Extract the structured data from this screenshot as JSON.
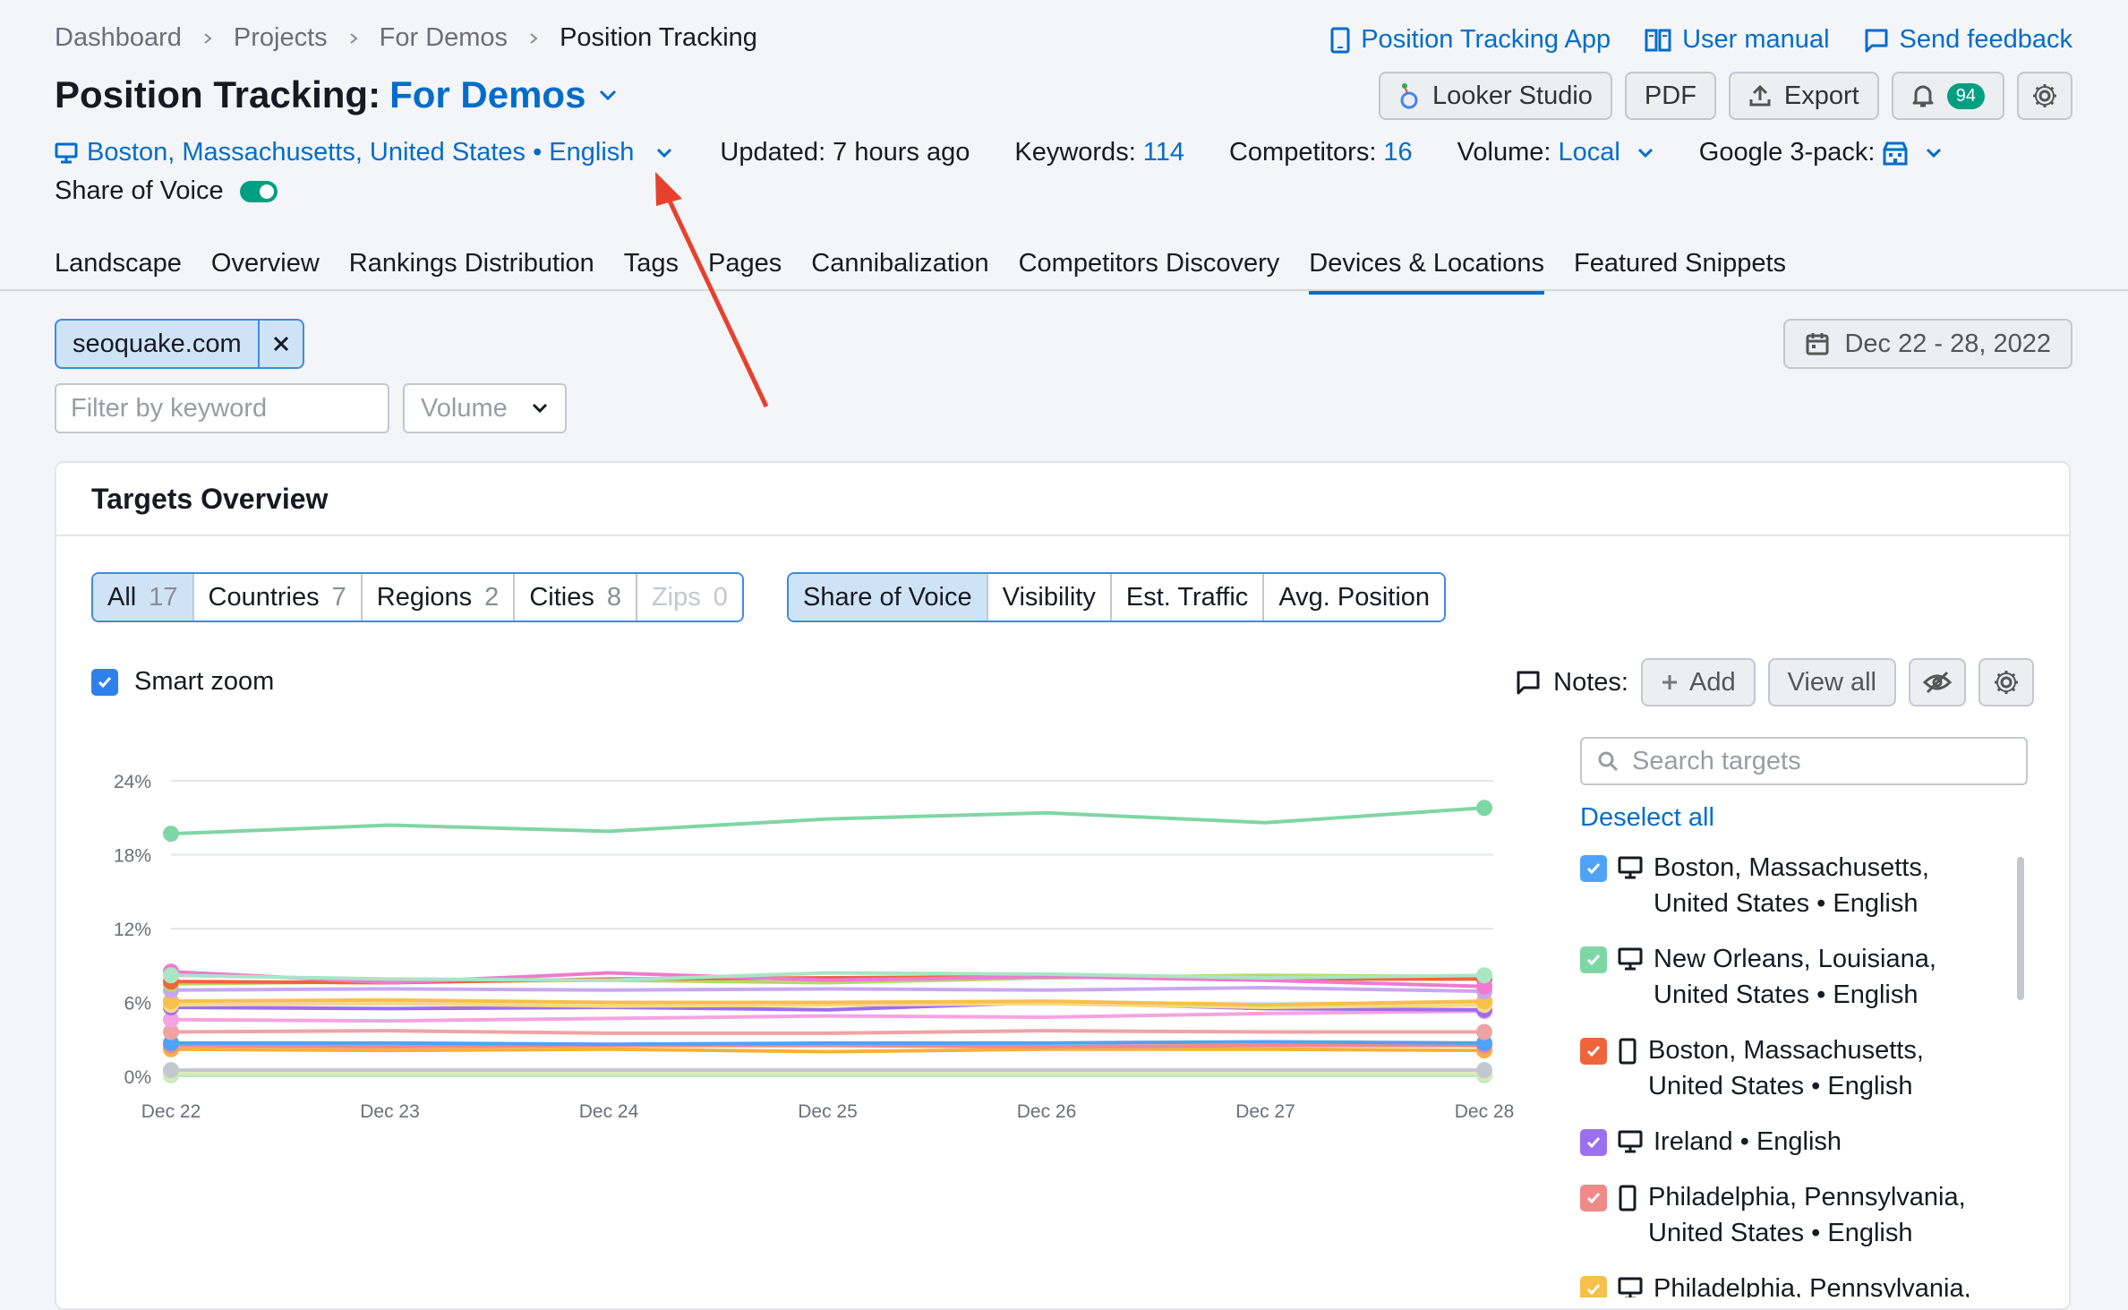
{
  "breadcrumb": [
    "Dashboard",
    "Projects",
    "For Demos",
    "Position Tracking"
  ],
  "top_links": {
    "app": "Position Tracking App",
    "manual": "User manual",
    "feedback": "Send feedback"
  },
  "title": {
    "prefix": "Position Tracking:",
    "project": "For Demos"
  },
  "toolbar": {
    "looker": "Looker Studio",
    "pdf": "PDF",
    "export": "Export",
    "notifications_count": "94"
  },
  "meta": {
    "location": "Boston, Massachusetts, United States • English",
    "updated_label": "Updated: 7 hours ago",
    "keywords_label": "Keywords:",
    "keywords_value": "114",
    "competitors_label": "Competitors:",
    "competitors_value": "16",
    "volume_label": "Volume:",
    "volume_value": "Local",
    "pack_label": "Google 3-pack:",
    "share_of_voice": "Share of Voice"
  },
  "tabs": [
    "Landscape",
    "Overview",
    "Rankings Distribution",
    "Tags",
    "Pages",
    "Cannibalization",
    "Competitors Discovery",
    "Devices & Locations",
    "Featured Snippets"
  ],
  "active_tab": "Devices & Locations",
  "domain_chip": "seoquake.com",
  "date_range": "Dec 22 - 28, 2022",
  "filter": {
    "placeholder": "Filter by keyword",
    "volume_placeholder": "Volume"
  },
  "card": {
    "title": "Targets Overview",
    "filters": [
      {
        "label": "All",
        "count": "17"
      },
      {
        "label": "Countries",
        "count": "7"
      },
      {
        "label": "Regions",
        "count": "2"
      },
      {
        "label": "Cities",
        "count": "8"
      },
      {
        "label": "Zips",
        "count": "0"
      }
    ],
    "metrics": [
      "Share of Voice",
      "Visibility",
      "Est. Traffic",
      "Avg. Position"
    ],
    "smart_zoom": "Smart zoom",
    "notes_label": "Notes:",
    "notes_add": "Add",
    "notes_view_all": "View all",
    "search_placeholder": "Search targets",
    "deselect_all": "Deselect all",
    "targets": [
      {
        "line1": "Boston, Massachusetts,",
        "line2": "United States • English",
        "color": "#4fa3f7",
        "device": "desktop"
      },
      {
        "line1": "New Orleans, Louisiana,",
        "line2": "United States • English",
        "color": "#7fd6a5",
        "device": "desktop"
      },
      {
        "line1": "Boston, Massachusetts,",
        "line2": "United States • English",
        "color": "#f0643c",
        "device": "mobile"
      },
      {
        "line1": "Ireland • English",
        "line2": "",
        "color": "#9c6ef0",
        "device": "desktop"
      },
      {
        "line1": "Philadelphia, Pennsylvania,",
        "line2": "United States • English",
        "color": "#f08a8a",
        "device": "mobile"
      },
      {
        "line1": "Philadelphia, Pennsylvania,",
        "line2": "",
        "color": "#f7c04a",
        "device": "desktop"
      }
    ]
  },
  "chart_data": {
    "type": "line",
    "x": [
      "Dec 22",
      "Dec 23",
      "Dec 24",
      "Dec 25",
      "Dec 26",
      "Dec 27",
      "Dec 28"
    ],
    "ylim": [
      0,
      24
    ],
    "yticks": [
      "0%",
      "6%",
      "12%",
      "18%",
      "24%"
    ],
    "series": [
      {
        "color": "#7fd6a5",
        "values": [
          19.7,
          20.4,
          19.9,
          20.9,
          21.4,
          20.6,
          21.8
        ]
      },
      {
        "color": "#a8e6c4",
        "values": [
          8.2,
          7.9,
          7.8,
          8.4,
          8.3,
          8.0,
          8.2
        ]
      },
      {
        "color": "#f07ad0",
        "values": [
          8.5,
          7.6,
          8.4,
          7.8,
          8.1,
          7.8,
          7.3
        ]
      },
      {
        "color": "#f0643c",
        "values": [
          7.7,
          7.6,
          7.9,
          8.0,
          8.1,
          7.9,
          7.9
        ]
      },
      {
        "color": "#b5d96a",
        "values": [
          7.5,
          7.7,
          7.8,
          7.6,
          8.0,
          8.2,
          8.1
        ]
      },
      {
        "color": "#c7a8f0",
        "values": [
          7.0,
          7.1,
          7.0,
          7.1,
          7.0,
          7.2,
          6.9
        ]
      },
      {
        "color": "#f7c04a",
        "values": [
          6.1,
          6.2,
          6.0,
          6.0,
          6.1,
          5.8,
          6.1
        ]
      },
      {
        "color": "#f5d98a",
        "values": [
          5.8,
          5.9,
          5.7,
          5.8,
          5.9,
          5.6,
          5.8
        ]
      },
      {
        "color": "#9c6ef0",
        "values": [
          5.6,
          5.5,
          5.6,
          5.4,
          6.0,
          5.5,
          5.4
        ]
      },
      {
        "color": "#f5a3e0",
        "values": [
          4.6,
          4.5,
          4.7,
          4.9,
          4.8,
          5.1,
          5.3
        ]
      },
      {
        "color": "#f0a3a3",
        "values": [
          3.6,
          3.7,
          3.5,
          3.5,
          3.7,
          3.6,
          3.6
        ]
      },
      {
        "color": "#4fa3f7",
        "values": [
          2.7,
          2.7,
          2.6,
          2.7,
          2.7,
          2.8,
          2.7
        ]
      },
      {
        "color": "#f08a8a",
        "values": [
          2.5,
          2.4,
          2.5,
          2.5,
          2.4,
          2.5,
          2.5
        ]
      },
      {
        "color": "#f7b03a",
        "values": [
          2.2,
          2.1,
          2.2,
          2.0,
          2.2,
          2.2,
          2.1
        ]
      },
      {
        "color": "#c4c7cf",
        "values": [
          0.5,
          0.5,
          0.5,
          0.5,
          0.5,
          0.5,
          0.5
        ]
      },
      {
        "color": "#d7ecb0",
        "values": [
          0.2,
          0.2,
          0.2,
          0.2,
          0.2,
          0.2,
          0.2
        ]
      },
      {
        "color": "#a8e6c4",
        "values": [
          0.1,
          0.1,
          0.1,
          0.1,
          0.1,
          0.1,
          0.1
        ]
      }
    ]
  }
}
